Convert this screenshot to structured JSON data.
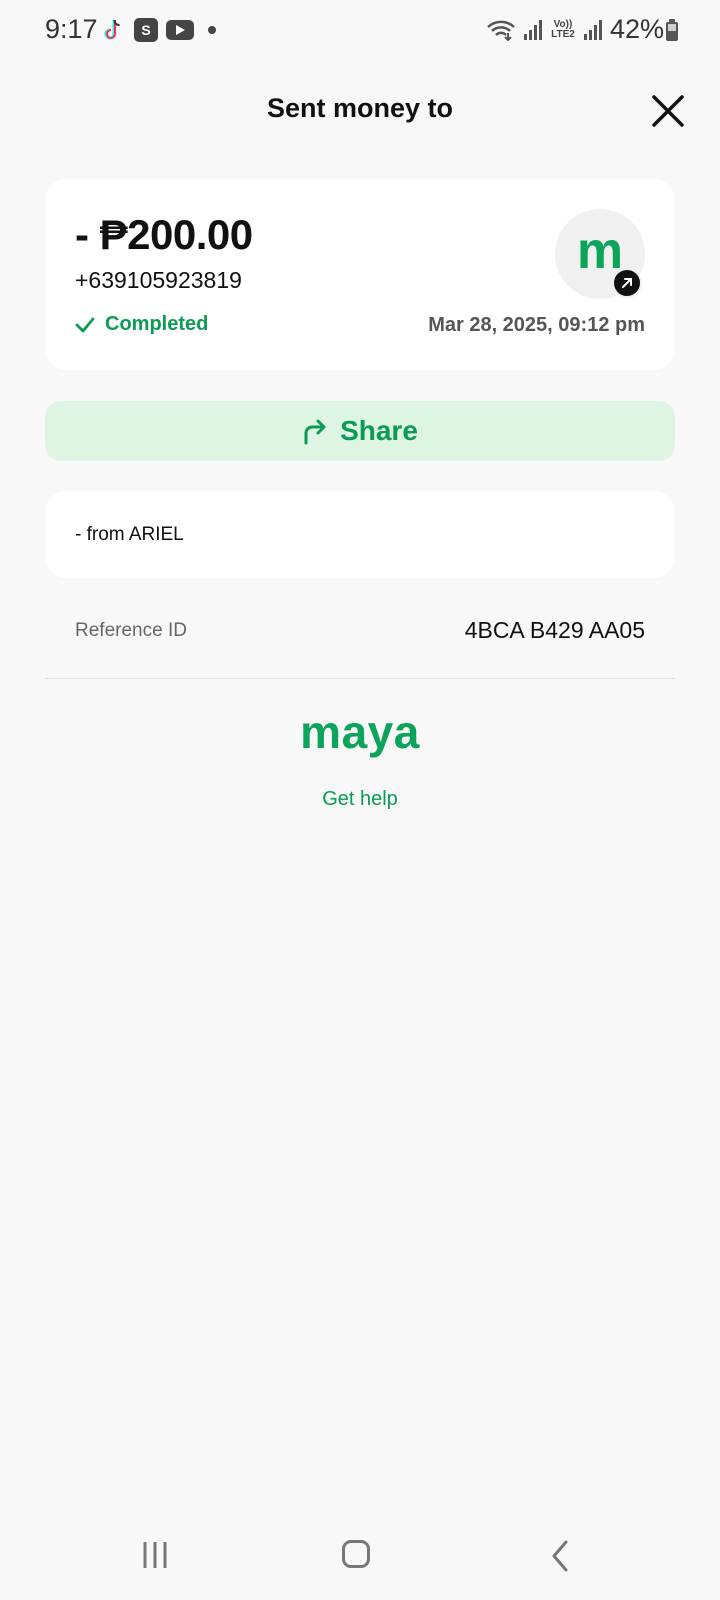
{
  "status_bar": {
    "time": "9:17",
    "battery": "42%",
    "network_label": "Vo)) LTE2",
    "app_icons": [
      "tiktok-icon",
      "shopee-icon",
      "youtube-icon"
    ]
  },
  "header": {
    "title": "Sent money to",
    "close_icon": "close-icon"
  },
  "transaction": {
    "amount": "- ₱200.00",
    "recipient": "+639105923819",
    "status": "Completed",
    "datetime": "Mar 28, 2025, 09:12 pm",
    "avatar_letter": "m"
  },
  "share": {
    "label": "Share"
  },
  "note": {
    "text": "- from ARIEL"
  },
  "reference": {
    "label": "Reference ID",
    "value": "4BCA B429 AA05"
  },
  "brand": {
    "logo_text": "maya"
  },
  "help": {
    "label": "Get help"
  },
  "colors": {
    "accent": "#0a9b55",
    "share_bg": "#ddf5e2",
    "page_bg": "#f8f8f8"
  }
}
